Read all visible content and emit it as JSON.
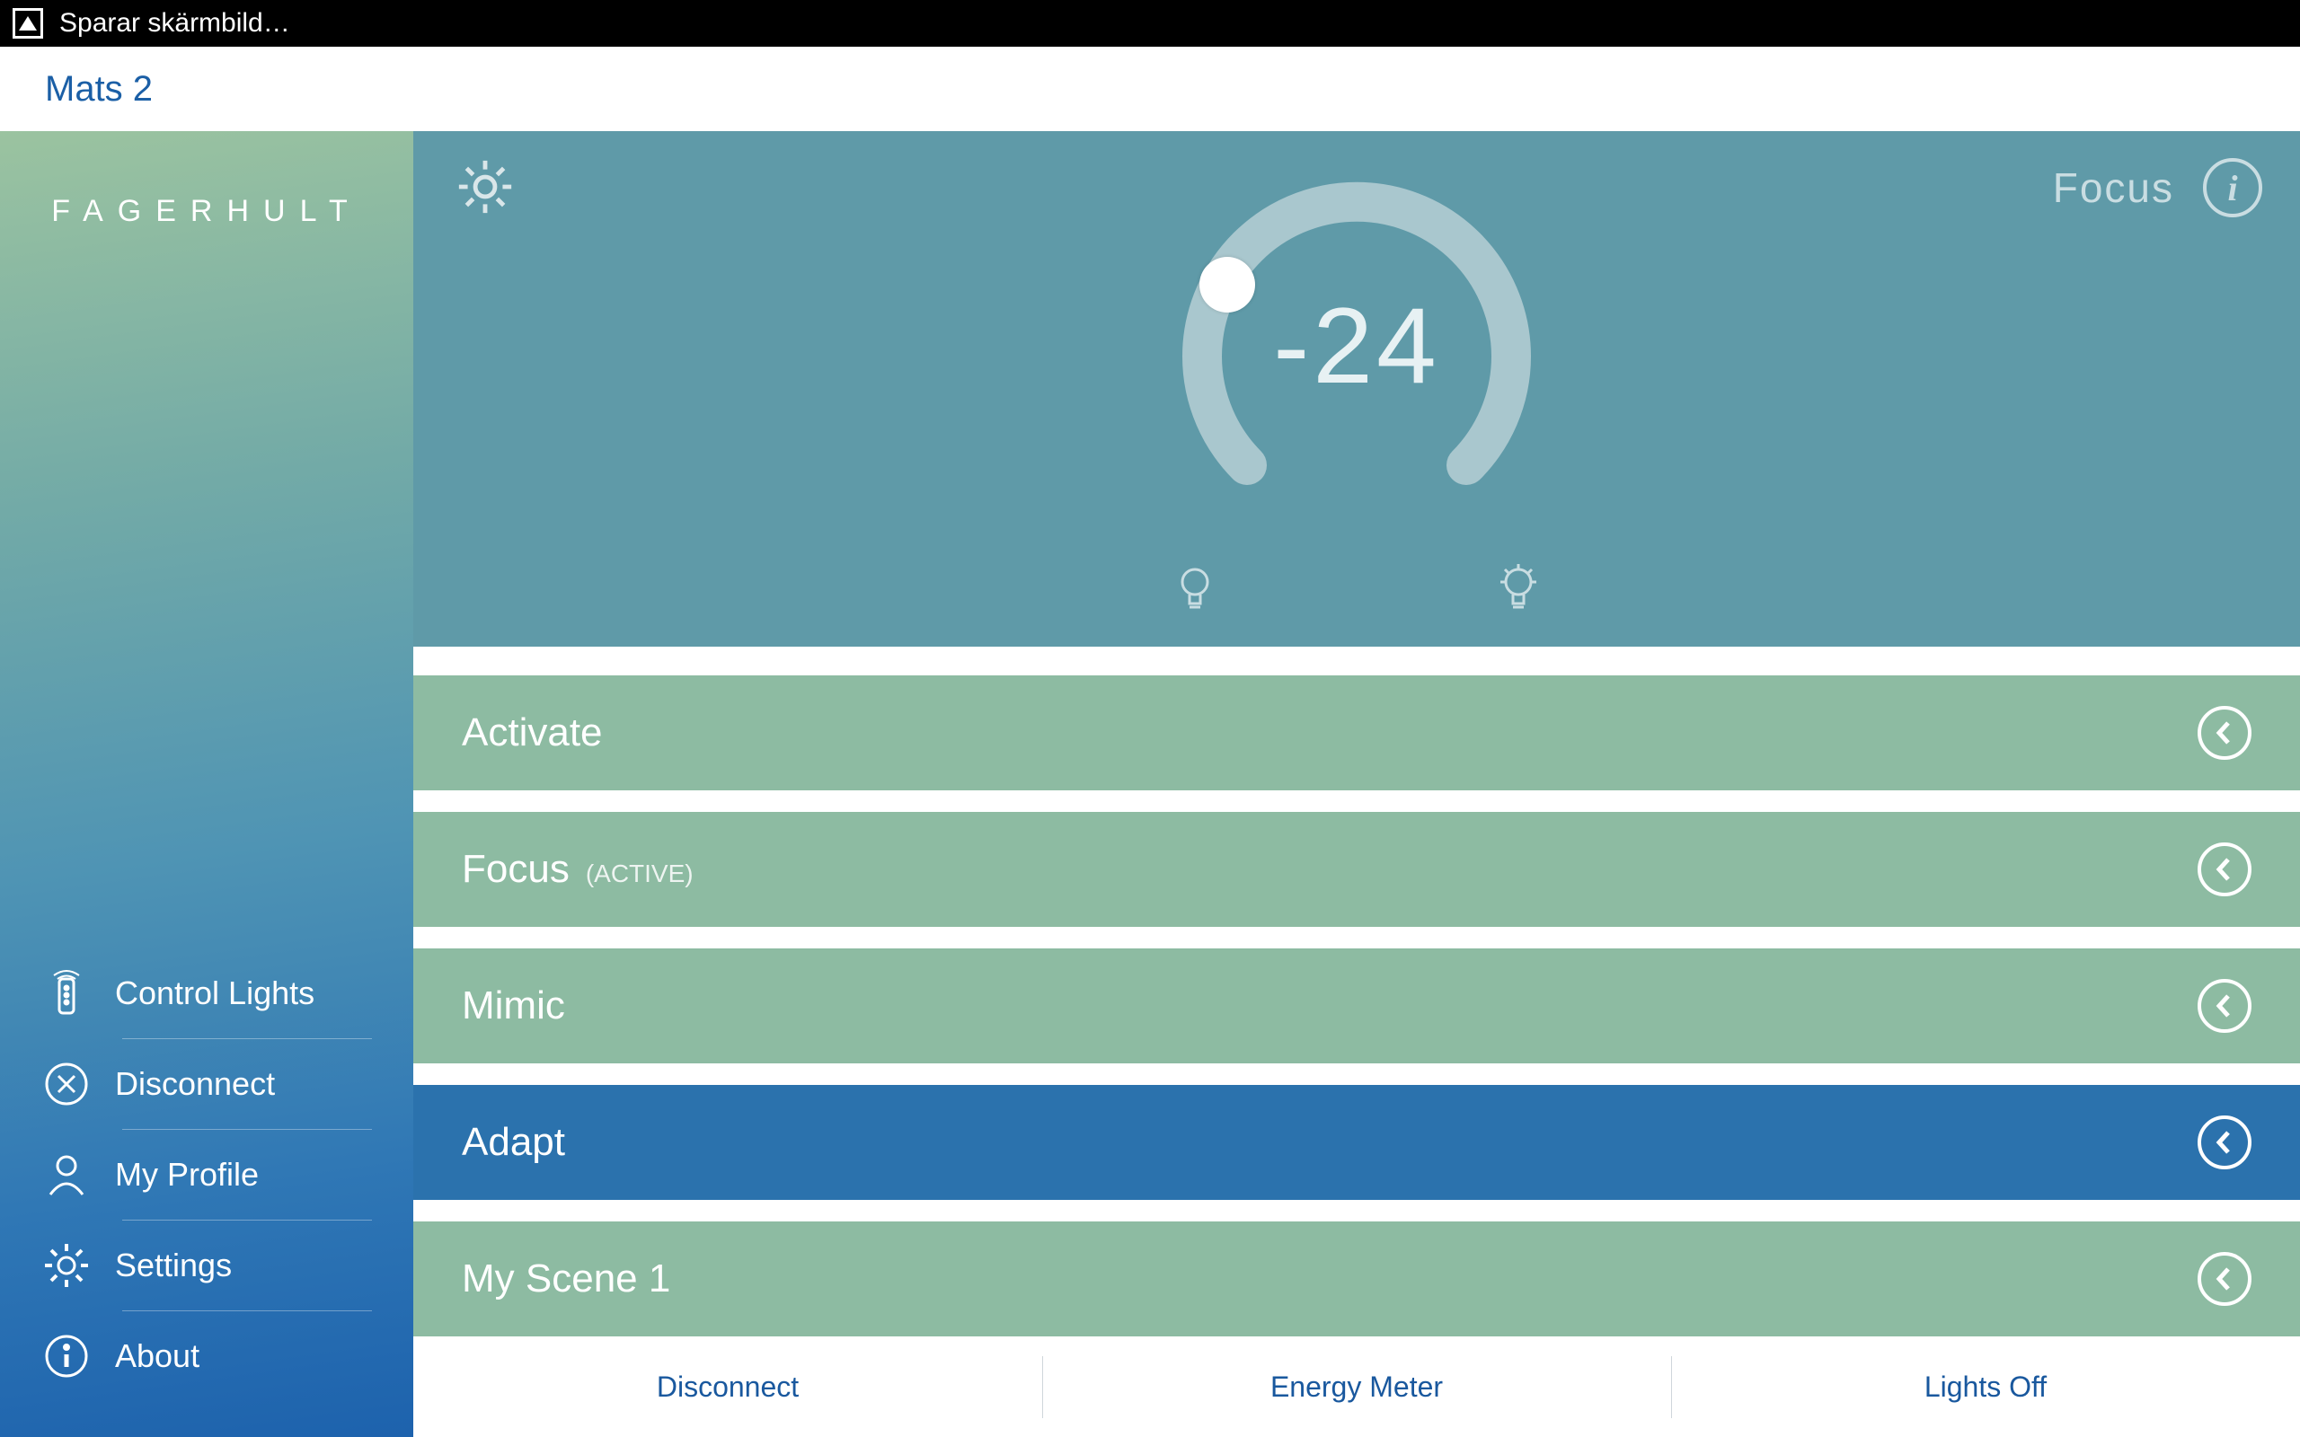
{
  "status_bar": {
    "text": "Sparar skärmbild…"
  },
  "device_bar": {
    "name": "Mats 2"
  },
  "brand": "FAGERHULT",
  "sidebar": {
    "items": [
      {
        "label": "Control Lights"
      },
      {
        "label": "Disconnect"
      },
      {
        "label": "My Profile"
      },
      {
        "label": "Settings"
      },
      {
        "label": "About"
      }
    ]
  },
  "dial": {
    "active_scene": "Focus",
    "value": "-24"
  },
  "scenes": [
    {
      "label": "Activate",
      "active": false,
      "highlighted": false
    },
    {
      "label": "Focus",
      "active": true,
      "active_tag": "(ACTIVE)",
      "highlighted": false
    },
    {
      "label": "Mimic",
      "active": false,
      "highlighted": false
    },
    {
      "label": "Adapt",
      "active": false,
      "highlighted": true
    },
    {
      "label": "My Scene 1",
      "active": false,
      "highlighted": false
    }
  ],
  "actions": [
    {
      "label": "Disconnect"
    },
    {
      "label": "Energy Meter"
    },
    {
      "label": "Lights Off"
    }
  ]
}
